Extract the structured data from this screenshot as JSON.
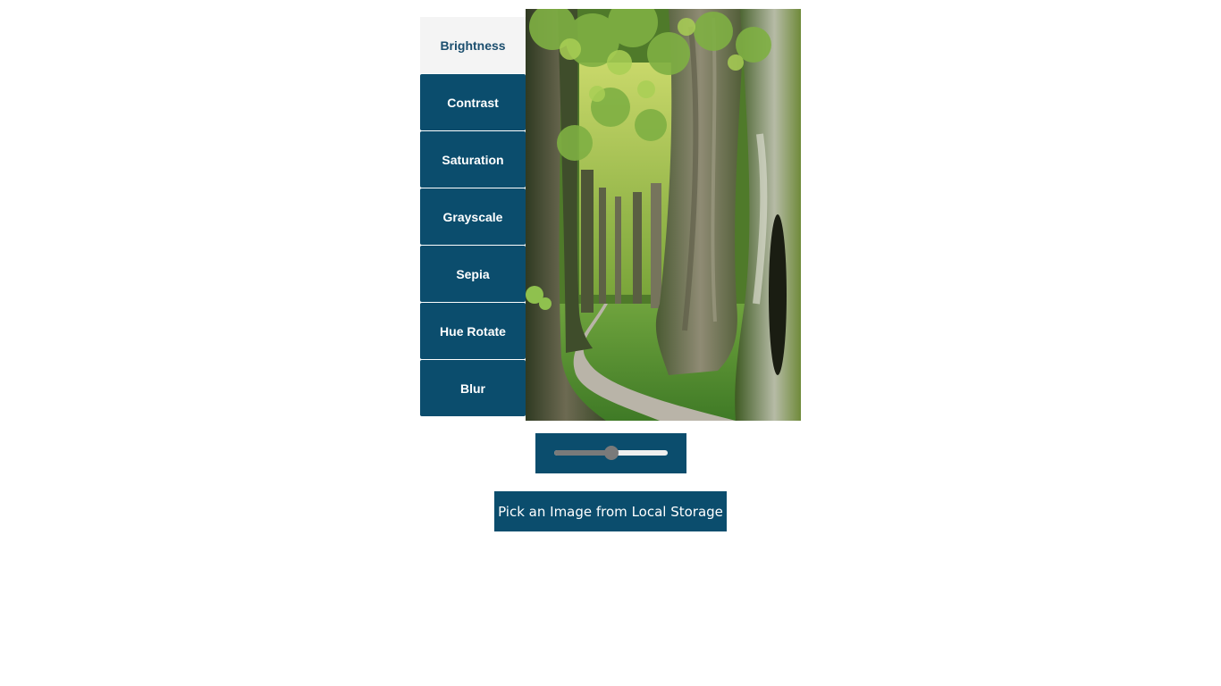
{
  "filters": {
    "items": [
      {
        "label": "Brightness",
        "active": true
      },
      {
        "label": "Contrast",
        "active": false
      },
      {
        "label": "Saturation",
        "active": false
      },
      {
        "label": "Grayscale",
        "active": false
      },
      {
        "label": "Sepia",
        "active": false
      },
      {
        "label": "Hue Rotate",
        "active": false
      },
      {
        "label": "Blur",
        "active": false
      }
    ]
  },
  "slider": {
    "value": 0.5
  },
  "pick_button": {
    "label": "Pick an Image from Local Storage"
  },
  "colors": {
    "primary": "#0b4d6d",
    "active_tab_bg": "#f4f4f4",
    "active_tab_text": "#1b4e6e"
  }
}
